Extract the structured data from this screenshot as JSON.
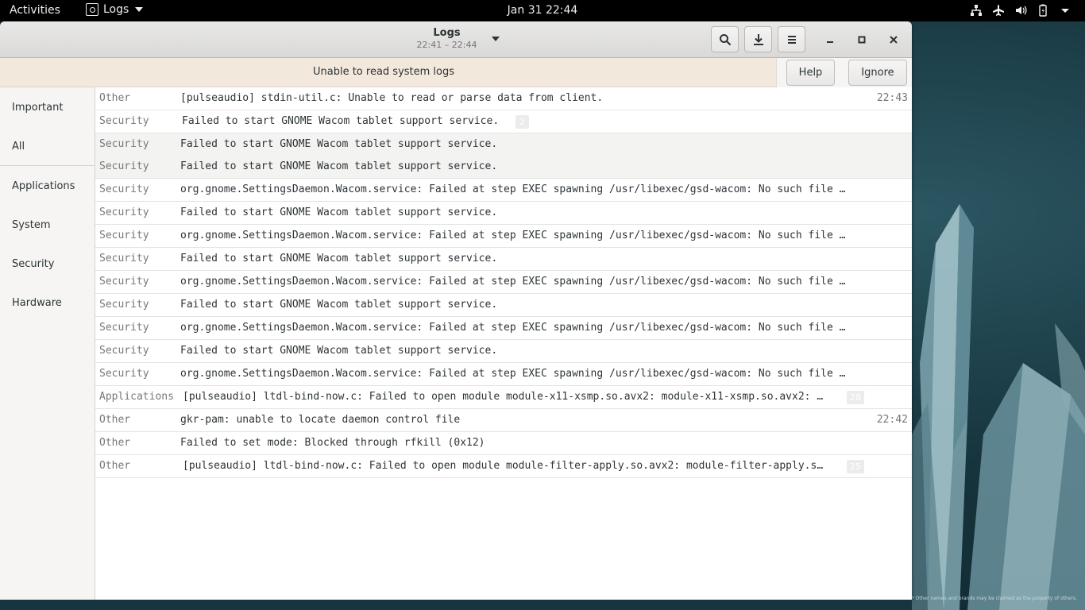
{
  "topbar": {
    "activities": "Activities",
    "app_name": "Logs",
    "clock": "Jan 31  22:44"
  },
  "window": {
    "title": "Logs",
    "subtitle": "22:41 – 22:44"
  },
  "infobar": {
    "message": "Unable to read system logs",
    "help_label": "Help",
    "ignore_label": "Ignore"
  },
  "sidebar": {
    "items": [
      {
        "label": "Important"
      },
      {
        "label": "All"
      },
      {
        "label": "Applications"
      },
      {
        "label": "System"
      },
      {
        "label": "Security"
      },
      {
        "label": "Hardware"
      }
    ]
  },
  "logs": [
    {
      "category": "Other",
      "message": "[pulseaudio] stdin-util.c: Unable to read or parse data from client.",
      "time": "22:43",
      "count": ""
    },
    {
      "category": "Security",
      "message": "Failed to start GNOME Wacom tablet support service.",
      "time": "",
      "count": "2"
    },
    {
      "category": "Security",
      "message": "Failed to start GNOME Wacom tablet support service.",
      "time": "",
      "count": ""
    },
    {
      "category": "Security",
      "message": "Failed to start GNOME Wacom tablet support service.",
      "time": "",
      "count": ""
    },
    {
      "category": "Security",
      "message": "org.gnome.SettingsDaemon.Wacom.service: Failed at step EXEC spawning /usr/libexec/gsd-wacom: No such file …",
      "time": "",
      "count": ""
    },
    {
      "category": "Security",
      "message": "Failed to start GNOME Wacom tablet support service.",
      "time": "",
      "count": ""
    },
    {
      "category": "Security",
      "message": "org.gnome.SettingsDaemon.Wacom.service: Failed at step EXEC spawning /usr/libexec/gsd-wacom: No such file …",
      "time": "",
      "count": ""
    },
    {
      "category": "Security",
      "message": "Failed to start GNOME Wacom tablet support service.",
      "time": "",
      "count": ""
    },
    {
      "category": "Security",
      "message": "org.gnome.SettingsDaemon.Wacom.service: Failed at step EXEC spawning /usr/libexec/gsd-wacom: No such file …",
      "time": "",
      "count": ""
    },
    {
      "category": "Security",
      "message": "Failed to start GNOME Wacom tablet support service.",
      "time": "",
      "count": ""
    },
    {
      "category": "Security",
      "message": "org.gnome.SettingsDaemon.Wacom.service: Failed at step EXEC spawning /usr/libexec/gsd-wacom: No such file …",
      "time": "",
      "count": ""
    },
    {
      "category": "Security",
      "message": "Failed to start GNOME Wacom tablet support service.",
      "time": "",
      "count": ""
    },
    {
      "category": "Security",
      "message": "org.gnome.SettingsDaemon.Wacom.service: Failed at step EXEC spawning /usr/libexec/gsd-wacom: No such file …",
      "time": "",
      "count": ""
    },
    {
      "category": "Applications",
      "message": "[pulseaudio] ltdl-bind-now.c: Failed to open module module-x11-xsmp.so.avx2: module-x11-xsmp.so.avx2: …",
      "time": "",
      "count": "28"
    },
    {
      "category": "Other",
      "message": "gkr-pam: unable to locate daemon control file",
      "time": "22:42",
      "count": ""
    },
    {
      "category": "Other",
      "message": "Failed to set mode: Blocked through rfkill (0x12)",
      "time": "",
      "count": ""
    },
    {
      "category": "Other",
      "message": "[pulseaudio] ltdl-bind-now.c: Failed to open module module-filter-apply.so.avx2: module-filter-apply.s…",
      "time": "",
      "count": "25"
    }
  ],
  "wallpaper_caption": "* Other names and brands may be claimed as the property of others."
}
